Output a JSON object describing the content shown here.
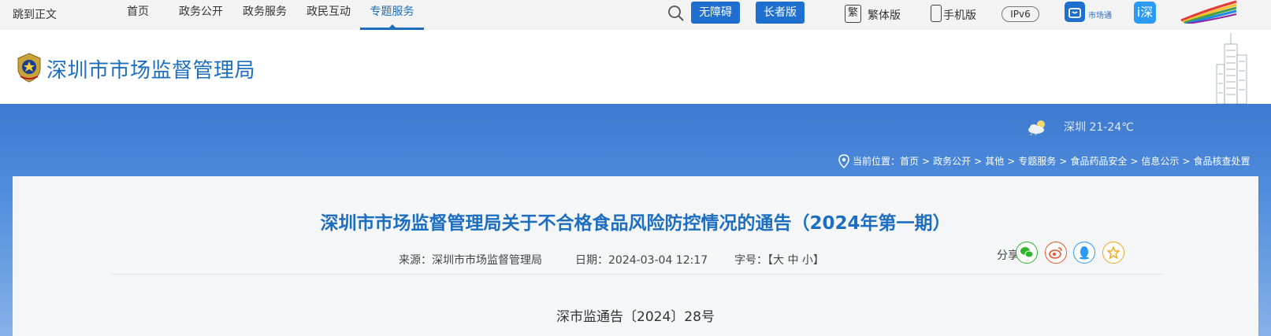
{
  "topbar": {
    "skip": "跳到正文",
    "nav": [
      {
        "label": "首页"
      },
      {
        "label": "政务公开"
      },
      {
        "label": "政务服务"
      },
      {
        "label": "政民互动"
      },
      {
        "label": "专题服务",
        "active": true
      }
    ],
    "accessibility_label": "无障碍",
    "elder_label": "长者版",
    "traditional_icon": "繁",
    "traditional_label": "繁体版",
    "mobile_label": "手机版",
    "ipv6_label": "IPv6",
    "app_label": "市场通",
    "app2_icon": "i深"
  },
  "header": {
    "site_title": "深圳市市场监督管理局"
  },
  "weather": {
    "text": "深圳 21-24℃"
  },
  "breadcrumb": {
    "prefix": "当前位置：",
    "items": [
      "首页",
      "政务公开",
      "其他",
      "专题服务",
      "食品药品安全",
      "信息公示",
      "食品核查处置"
    ],
    "separator": ">"
  },
  "article": {
    "title": "深圳市市场监督管理局关于不合格食品风险防控情况的通告（2024年第一期）",
    "source": "来源：深圳市市场监督管理局",
    "date": "日期：2024-03-04 12:17",
    "font_size": "字号：【大  中  小】",
    "share_label": "分享到：",
    "doc_number": "深市监通告〔2024〕28号"
  },
  "colors": {
    "brand_blue": "#1d6ec0",
    "button_blue": "#1f6fd1",
    "wechat": "#2fb42d",
    "weibo": "#e6562c",
    "qq": "#2b9af3",
    "favorite": "#f2a51d"
  }
}
